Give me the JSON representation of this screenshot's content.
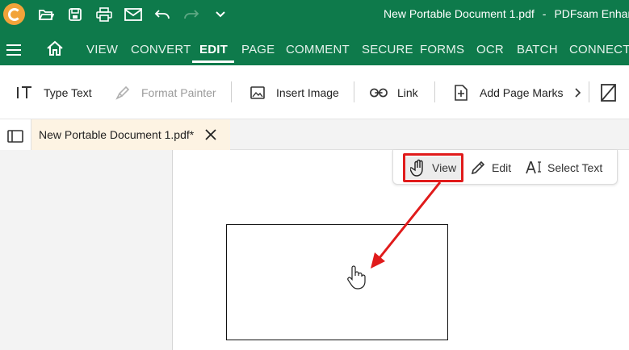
{
  "titlebar": {
    "document": "New Portable Document 1.pdf",
    "separator": "-",
    "app": "PDFsam Enhan",
    "quick_access": [
      "open-icon",
      "save-icon",
      "print-icon",
      "email-icon",
      "undo-icon",
      "redo-icon",
      "customize-icon"
    ]
  },
  "menu": {
    "items": [
      "VIEW",
      "CONVERT",
      "EDIT",
      "PAGE",
      "COMMENT",
      "SECURE",
      "FORMS",
      "OCR",
      "BATCH",
      "CONNECT"
    ],
    "active": "EDIT"
  },
  "toolbar": {
    "type_text": "Type Text",
    "format_painter": "Format Painter",
    "insert_image": "Insert Image",
    "link": "Link",
    "add_page_marks": "Add Page Marks"
  },
  "tab": {
    "title": "New Portable Document 1.pdf*"
  },
  "modes": {
    "view": "View",
    "edit": "Edit",
    "select_text": "Select Text",
    "active": "View"
  },
  "colors": {
    "brand": "#0e7a4b",
    "highlight": "#e01b1b",
    "tab_background": "#fdf3e3"
  }
}
